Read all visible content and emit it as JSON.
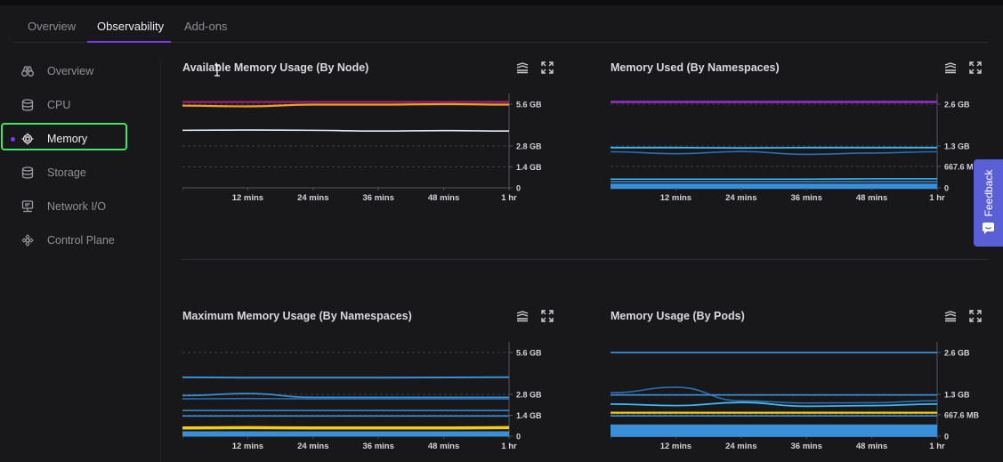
{
  "tabs": [
    {
      "label": "Overview",
      "active": false
    },
    {
      "label": "Observability",
      "active": true
    },
    {
      "label": "Add-ons",
      "active": false
    }
  ],
  "sidebar": {
    "items": [
      {
        "label": "Overview",
        "icon": "binoculars-icon",
        "active": false
      },
      {
        "label": "CPU",
        "icon": "database-icon",
        "active": false
      },
      {
        "label": "Memory",
        "icon": "memory-chip-icon",
        "active": true
      },
      {
        "label": "Storage",
        "icon": "database-icon",
        "active": false
      },
      {
        "label": "Network I/O",
        "icon": "network-icon",
        "active": false
      },
      {
        "label": "Control Plane",
        "icon": "control-plane-icon",
        "active": false
      }
    ]
  },
  "feedback": {
    "label": "Feedback"
  },
  "colors": {
    "accent": "#7c3aed",
    "highlight": "#3ee567",
    "feedback": "#5b5fd6",
    "blue": "#3a8fd9",
    "light_blue": "#3fb8f5",
    "magenta": "#b01d7a",
    "orange": "#f0a021",
    "yellow": "#f5cc1a",
    "purple": "#a32ee0",
    "white": "#e4f1ff"
  },
  "chart_data": [
    {
      "type": "line",
      "title": "Available Memory Usage (By Node)",
      "x_ticks": [
        "12 mins",
        "24 mins",
        "36 mins",
        "48 mins",
        "1 hr"
      ],
      "y_ticks": [
        {
          "value": 0,
          "label": "0"
        },
        {
          "value": 1.4,
          "label": "1.4 GB"
        },
        {
          "value": 2.8,
          "label": "2.8 GB"
        },
        {
          "value": 5.6,
          "label": "5.6 GB"
        }
      ],
      "ylim": [
        0,
        5.6
      ],
      "series": [
        {
          "color": "#b01d7a",
          "width": 2,
          "values": [
            5.75,
            5.75,
            5.75,
            5.75,
            5.75,
            5.75
          ]
        },
        {
          "color": "#f0a021",
          "width": 2.2,
          "values": [
            5.5,
            5.45,
            5.57,
            5.57,
            5.6,
            5.57
          ]
        },
        {
          "color": "#e4f1ff",
          "width": 1.6,
          "values": [
            3.85,
            3.87,
            3.85,
            3.8,
            3.83,
            3.8
          ]
        }
      ]
    },
    {
      "type": "line",
      "title": "Memory Used (By Namespaces)",
      "x_ticks": [
        "12 mins",
        "24 mins",
        "36 mins",
        "48 mins",
        "1 hr"
      ],
      "y_ticks": [
        {
          "value": 0,
          "label": "0"
        },
        {
          "value": 0.6676,
          "label": "667.6 MB"
        },
        {
          "value": 1.3,
          "label": "1.3 GB"
        },
        {
          "value": 2.6,
          "label": "2.6 GB"
        }
      ],
      "ylim": [
        0,
        2.6
      ],
      "series": [
        {
          "color": "#a32ee0",
          "width": 2.2,
          "values": [
            2.67,
            2.67,
            2.67,
            2.67,
            2.67,
            2.67
          ]
        },
        {
          "color": "#3fb8f5",
          "width": 1.8,
          "values": [
            1.25,
            1.25,
            1.24,
            1.25,
            1.25,
            1.25
          ]
        },
        {
          "color": "#2a6fb0",
          "width": 1.6,
          "values": [
            1.12,
            1.06,
            1.13,
            1.04,
            1.08,
            1.12
          ]
        },
        {
          "color": "#3fb8f5",
          "width": 1.6,
          "values": [
            0.27,
            0.27,
            0.27,
            0.27,
            0.28,
            0.28
          ]
        },
        {
          "color": "#3a8fd9",
          "width": 1.6,
          "values": [
            0.19,
            0.19,
            0.19,
            0.19,
            0.19,
            0.19
          ]
        },
        {
          "color": "#3a8fd9",
          "width": 6,
          "values": [
            0.05,
            0.05,
            0.05,
            0.05,
            0.05,
            0.05
          ]
        }
      ]
    },
    {
      "type": "line",
      "title": "Maximum Memory Usage (By Namespaces)",
      "x_ticks": [
        "12 mins",
        "24 mins",
        "36 mins",
        "48 mins",
        "1 hr"
      ],
      "y_ticks": [
        {
          "value": 0,
          "label": "0"
        },
        {
          "value": 1.4,
          "label": "1.4 GB"
        },
        {
          "value": 2.8,
          "label": "2.8 GB"
        },
        {
          "value": 5.6,
          "label": "5.6 GB"
        }
      ],
      "ylim": [
        0,
        5.6
      ],
      "series": [
        {
          "color": "#3a8fd9",
          "width": 2,
          "values": [
            3.94,
            3.92,
            3.92,
            3.92,
            3.93,
            3.95
          ]
        },
        {
          "color": "#3a8fd9",
          "width": 1.8,
          "values": [
            2.72,
            2.85,
            2.6,
            2.6,
            2.6,
            2.6
          ]
        },
        {
          "color": "#2a6fb0",
          "width": 1.6,
          "values": [
            2.5,
            2.52,
            2.5,
            2.5,
            2.5,
            2.5
          ]
        },
        {
          "color": "#3a8fd9",
          "width": 1.6,
          "values": [
            1.72,
            1.72,
            1.72,
            1.72,
            1.72,
            1.72
          ]
        },
        {
          "color": "#3a8fd9",
          "width": 1.6,
          "values": [
            1.35,
            1.35,
            1.35,
            1.35,
            1.35,
            1.35
          ]
        },
        {
          "color": "#f5cc1a",
          "width": 3.5,
          "values": [
            0.55,
            0.57,
            0.55,
            0.55,
            0.55,
            0.57
          ]
        },
        {
          "color": "#3a8fd9",
          "width": 6,
          "values": [
            0.15,
            0.15,
            0.15,
            0.15,
            0.15,
            0.15
          ]
        }
      ]
    },
    {
      "type": "line",
      "title": "Memory Usage (By Pods)",
      "x_ticks": [
        "12 mins",
        "24 mins",
        "36 mins",
        "48 mins",
        "1 hr"
      ],
      "y_ticks": [
        {
          "value": 0,
          "label": "0"
        },
        {
          "value": 0.6676,
          "label": "667.6 MB"
        },
        {
          "value": 1.3,
          "label": "1.3 GB"
        },
        {
          "value": 2.6,
          "label": "2.6 GB"
        }
      ],
      "ylim": [
        0,
        2.6
      ],
      "series": [
        {
          "color": "#3a8fd9",
          "width": 1.8,
          "values": [
            2.6,
            2.6,
            2.6,
            2.6,
            2.6,
            2.6
          ]
        },
        {
          "color": "#2a6fb0",
          "width": 1.6,
          "values": [
            1.35,
            1.52,
            1.1,
            1.03,
            1.04,
            1.1
          ]
        },
        {
          "color": "#3a8fd9",
          "width": 1.6,
          "values": [
            1.28,
            1.28,
            1.28,
            1.28,
            1.28,
            1.28
          ]
        },
        {
          "color": "#3fb8f5",
          "width": 1.8,
          "values": [
            1.0,
            0.95,
            1.05,
            0.93,
            0.95,
            1.0
          ]
        },
        {
          "color": "#f5cc1a",
          "width": 2.2,
          "values": [
            0.73,
            0.73,
            0.73,
            0.73,
            0.73,
            0.73
          ]
        },
        {
          "color": "#3a8fd9",
          "width": 1.6,
          "values": [
            0.63,
            0.63,
            0.63,
            0.63,
            0.63,
            0.63
          ]
        },
        {
          "color": "#3a8fd9",
          "width": 14,
          "values": [
            0.17,
            0.17,
            0.17,
            0.17,
            0.17,
            0.17
          ]
        }
      ]
    }
  ]
}
